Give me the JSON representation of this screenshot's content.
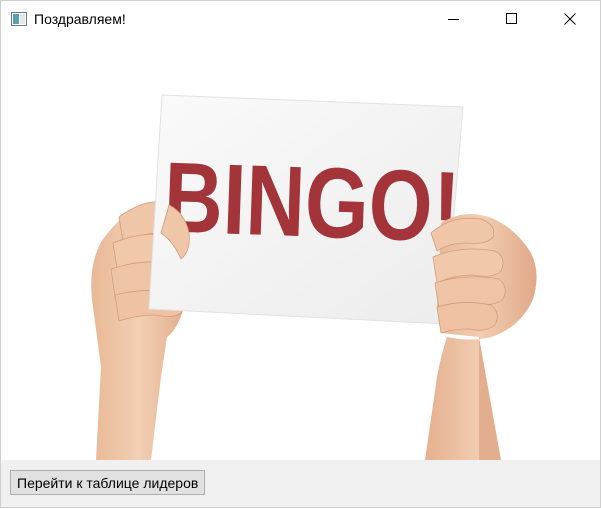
{
  "window": {
    "title": "Поздравляем!"
  },
  "image": {
    "sign_text": "BINGO!"
  },
  "actions": {
    "leaderboard_button_label": "Перейти к таблице лидеров"
  },
  "colors": {
    "sign_text": "#a3353a",
    "sign_paper": "#f4f4f4",
    "skin": "#f0c9ad",
    "bottom_bar": "#f0f0f0",
    "button_bg": "#e1e1e1"
  }
}
